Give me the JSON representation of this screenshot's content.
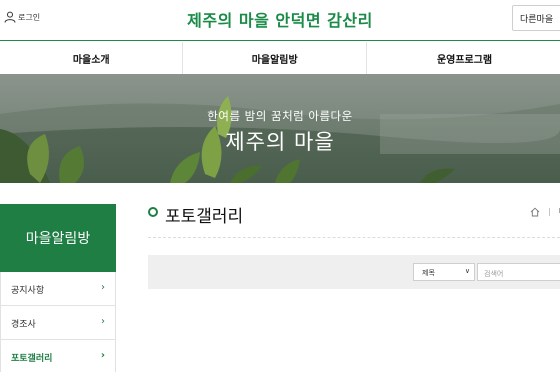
{
  "header": {
    "login_label": "로그인",
    "site_title": "제주의 마을 안덕면 감산리",
    "other_village_label": "다른마을"
  },
  "nav": {
    "items": [
      "마을소개",
      "마을알림방",
      "운영프로그램"
    ]
  },
  "banner": {
    "subtitle": "한여름 밤의 꿈처럼 아름다운",
    "title": "제주의 마을"
  },
  "sidebar": {
    "heading": "마을알림방",
    "items": [
      {
        "label": "공지사항"
      },
      {
        "label": "경조사"
      },
      {
        "label": "포토갤러리"
      }
    ]
  },
  "content": {
    "page_title": "포토갤러리",
    "breadcrumb_fragment": "마"
  },
  "search": {
    "select_value": "제목",
    "placeholder": "검색어"
  },
  "colors": {
    "accent": "#1e7e44",
    "title_green": "#1a8a47",
    "search_bg": "#efefef"
  }
}
